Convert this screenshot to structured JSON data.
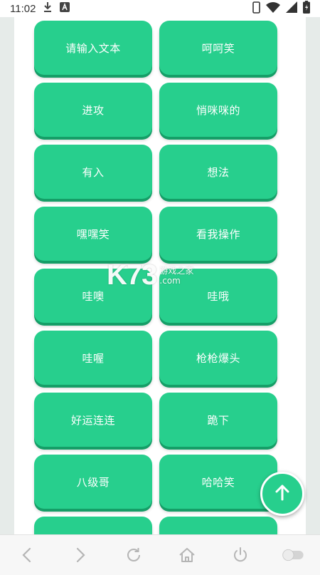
{
  "status_bar": {
    "time": "11:02",
    "icons": [
      "download-icon",
      "font-icon",
      "phone-icon",
      "wifi-icon",
      "signal-icon",
      "battery-icon"
    ]
  },
  "buttons": [
    {
      "label": "请输入文本"
    },
    {
      "label": "呵呵笑"
    },
    {
      "label": "进攻"
    },
    {
      "label": "悄咪咪的"
    },
    {
      "label": "有入"
    },
    {
      "label": "想法"
    },
    {
      "label": "嘿嘿笑"
    },
    {
      "label": "看我操作"
    },
    {
      "label": "哇噢"
    },
    {
      "label": "哇哦"
    },
    {
      "label": "哇喔"
    },
    {
      "label": "枪枪爆头"
    },
    {
      "label": "好运连连"
    },
    {
      "label": "跪下"
    },
    {
      "label": "八级哥"
    },
    {
      "label": "哈哈笑"
    },
    {
      "label": ""
    },
    {
      "label": ""
    }
  ],
  "watermark": {
    "brand": "K73",
    "line1": "游戏之家",
    "line2": ".com"
  },
  "colors": {
    "button": "#27cf8d",
    "button_shadow": "#159e67",
    "nav_icon": "#b5b5b5"
  },
  "nav_bar": {
    "icons": [
      "back-arrow-icon",
      "forward-arrow-icon",
      "refresh-icon",
      "home-icon",
      "power-icon",
      "toggle-icon"
    ]
  }
}
